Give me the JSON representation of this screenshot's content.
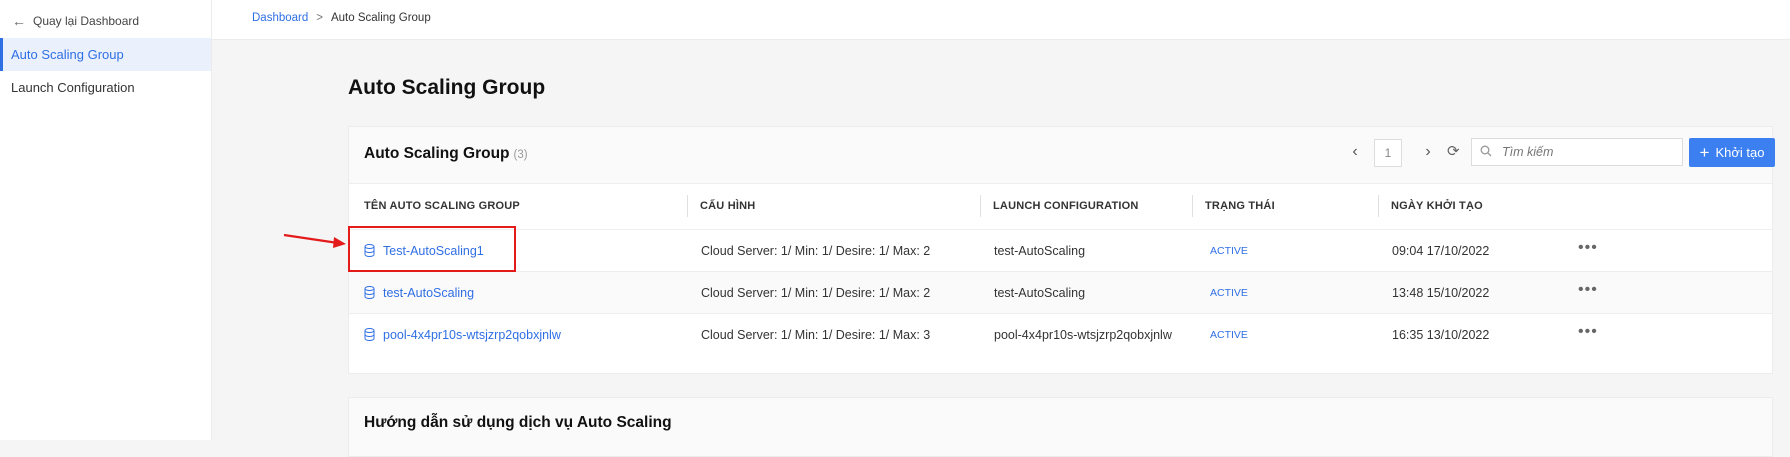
{
  "sidebar": {
    "back_label": "Quay lại Dashboard",
    "items": [
      {
        "label": "Auto Scaling Group",
        "active": true
      },
      {
        "label": "Launch Configuration",
        "active": false
      }
    ]
  },
  "breadcrumb": {
    "home": "Dashboard",
    "separator": ">",
    "current": "Auto Scaling Group"
  },
  "page_title": "Auto Scaling Group",
  "table_card": {
    "title": "Auto Scaling Group",
    "count": "(3)",
    "pagination": {
      "current_page": "1"
    },
    "search": {
      "placeholder": "Tìm kiếm",
      "value": ""
    },
    "create_label": "Khởi tạo",
    "columns": [
      "TÊN AUTO SCALING GROUP",
      "CẤU HÌNH",
      "LAUNCH CONFIGURATION",
      "TRẠNG THÁI",
      "NGÀY KHỞI TẠO"
    ],
    "rows": [
      {
        "name": "Test-AutoScaling1",
        "config": "Cloud Server: 1/ Min: 1/ Desire: 1/ Max: 2",
        "launch_config": "test-AutoScaling",
        "status": "ACTIVE",
        "created": "09:04 17/10/2022"
      },
      {
        "name": "test-AutoScaling",
        "config": "Cloud Server: 1/ Min: 1/ Desire: 1/ Max: 2",
        "launch_config": "test-AutoScaling",
        "status": "ACTIVE",
        "created": "13:48 15/10/2022"
      },
      {
        "name": "pool-4x4pr10s-wtsjzrp2qobxjnlw",
        "config": "Cloud Server: 1/ Min: 1/ Desire: 1/ Max: 3",
        "launch_config": "pool-4x4pr10s-wtsjzrp2qobxjnlw",
        "status": "ACTIVE",
        "created": "16:35 13/10/2022"
      }
    ]
  },
  "guide_card": {
    "title": "Hướng dẫn sử dụng dịch vụ Auto Scaling"
  },
  "colors": {
    "accent": "#3b7ff0",
    "link": "#2f6fe4",
    "annotation": "#e31b1b"
  }
}
